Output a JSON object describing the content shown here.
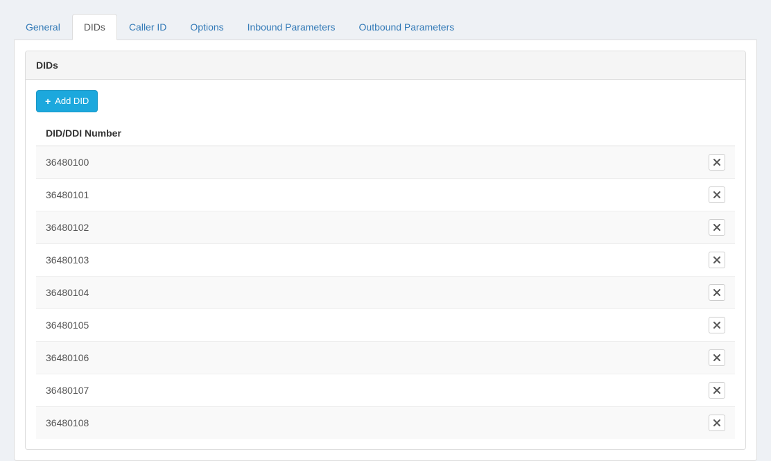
{
  "tabs": [
    {
      "label": "General",
      "active": false
    },
    {
      "label": "DIDs",
      "active": true
    },
    {
      "label": "Caller ID",
      "active": false
    },
    {
      "label": "Options",
      "active": false
    },
    {
      "label": "Inbound Parameters",
      "active": false
    },
    {
      "label": "Outbound Parameters",
      "active": false
    }
  ],
  "panel": {
    "title": "DIDs",
    "add_label": "Add DID",
    "column_header": "DID/DDI Number",
    "rows": [
      {
        "number": "36480100"
      },
      {
        "number": "36480101"
      },
      {
        "number": "36480102"
      },
      {
        "number": "36480103"
      },
      {
        "number": "36480104"
      },
      {
        "number": "36480105"
      },
      {
        "number": "36480106"
      },
      {
        "number": "36480107"
      },
      {
        "number": "36480108"
      }
    ]
  }
}
